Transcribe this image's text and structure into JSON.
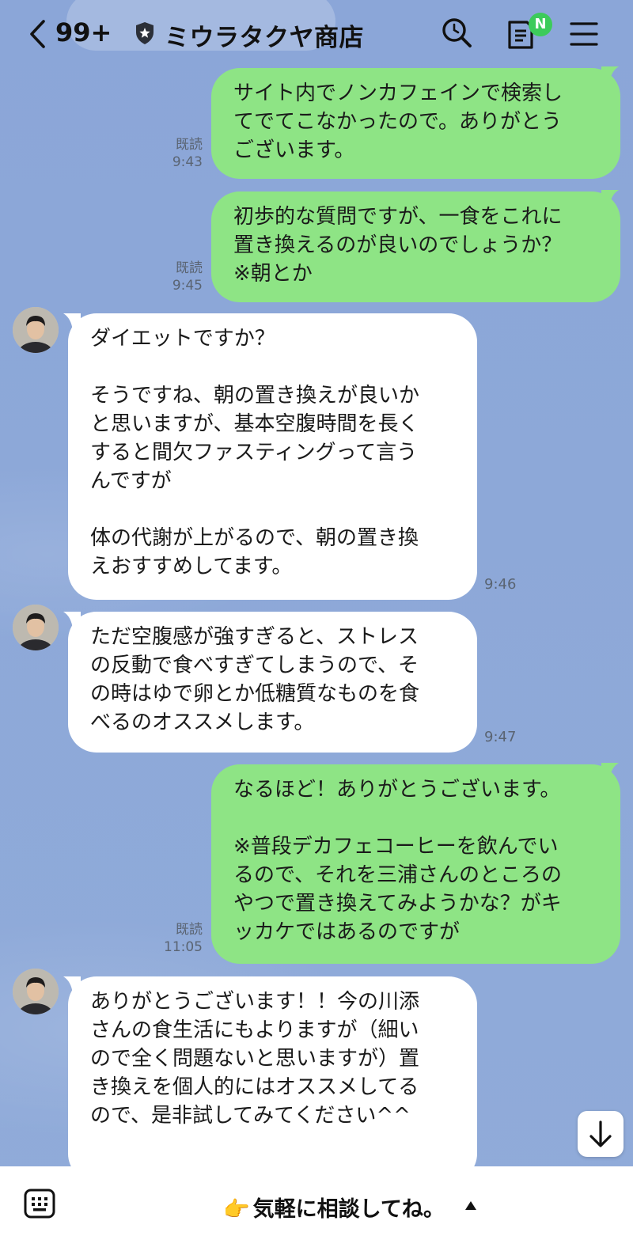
{
  "header": {
    "back_label": "<",
    "unread_count": "99+",
    "title": "ミウラタクヤ商店",
    "badge": "N",
    "icons": [
      "chevron-left-icon",
      "shield-star-icon",
      "search-icon",
      "note-icon",
      "menu-icon"
    ]
  },
  "messages": [
    {
      "side": "out",
      "text": "サイト内でノンカフェインで検索し\nてでてこなかったので。ありがとう\nございます。",
      "read": "既読",
      "time": "9:43"
    },
    {
      "side": "out",
      "text": "初歩的な質問ですが、一食をこれに\n置き換えるのが良いのでしょうか？\n※朝とか",
      "read": "既読",
      "time": "9:45"
    },
    {
      "side": "in",
      "text": "ダイエットですか？\n\nそうですね、朝の置き換えが良いか\nと思いますが、基本空腹時間を長く\nすると間欠ファスティングって言う\nんですが\n\n体の代謝が上がるので、朝の置き換\nえおすすめしてます。",
      "time": "9:46"
    },
    {
      "side": "in",
      "text": "ただ空腹感が強すぎると、ストレス\nの反動で食べすぎてしまうので、そ\nの時はゆで卵とか低糖質なものを食\nべるのオススメします。",
      "time": "9:47"
    },
    {
      "side": "out",
      "text": "なるほど！ありがとうございます。\n\n※普段デカフェコーヒーを飲んでい\nるので、それを三浦さんのところの\nやつで置き換えてみようかな？がキ\nッカケではあるのですが",
      "read": "既読",
      "time": "11:05"
    },
    {
      "side": "in",
      "text": "ありがとうございます！！今の川添\nさんの食生活にもよりますが（細い\nので全く問題ないと思いますが）置\nき換えを個人的にはオススメしてる\nので、是非試してみてください^^",
      "time": ""
    }
  ],
  "footer": {
    "cta_emoji": "👉",
    "cta_label": "気軽に相談してね。",
    "icons": [
      "keyboard-icon",
      "caret-up-icon"
    ]
  },
  "colors": {
    "background": "#8da8d8",
    "outgoing_bubble": "#8ee485",
    "incoming_bubble": "#ffffff",
    "badge": "#3ccb5a"
  }
}
